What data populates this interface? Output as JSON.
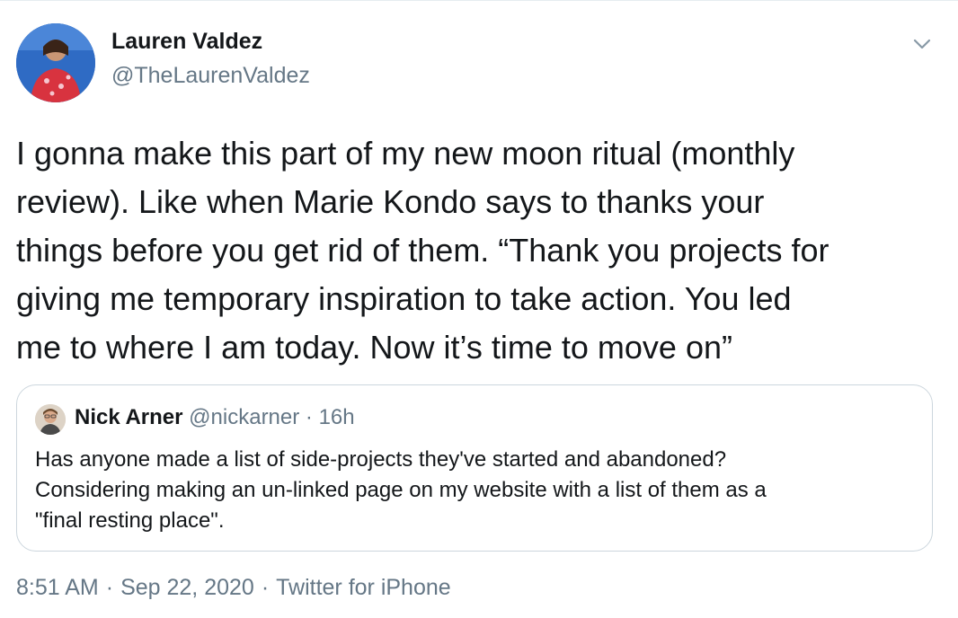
{
  "author": {
    "display_name": "Lauren Valdez",
    "handle": "@TheLaurenValdez",
    "avatar_icon": "profile-photo-icon"
  },
  "menu": {
    "icon": "chevron-down-icon"
  },
  "tweet": {
    "lines": [
      "I gonna make this part of my new moon ritual (monthly",
      "review). Like when Marie Kondo says to thanks your",
      "things before you get rid of them. “Thank you projects for",
      "giving me temporary inspiration to take action. You led",
      "me to where I am today. Now it’s time to move on”"
    ]
  },
  "quoted_tweet": {
    "display_name": "Nick Arner",
    "handle": "@nickarner",
    "separator": " · ",
    "time": "16h",
    "lines": [
      "Has anyone made a list of side-projects they've started and abandoned?",
      "Considering making an un-linked page on my website with a list of them as a",
      "\"final resting place\"."
    ]
  },
  "footer": {
    "time": "8:51 AM",
    "date": "Sep 22, 2020",
    "source": "Twitter for iPhone",
    "separator": "·"
  },
  "colors": {
    "text": "#14171a",
    "secondary": "#657786",
    "border": "#ccd6dd"
  }
}
